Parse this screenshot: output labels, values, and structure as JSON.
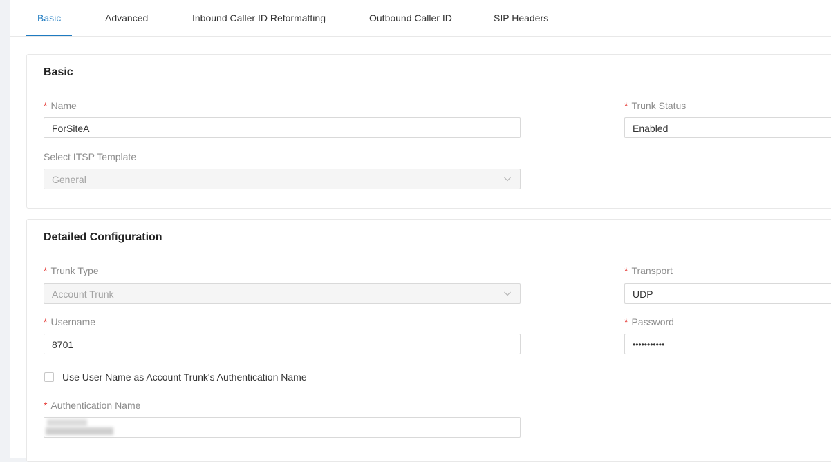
{
  "tabs": [
    {
      "label": "Basic",
      "active": true
    },
    {
      "label": "Advanced"
    },
    {
      "label": "Inbound Caller ID Reformatting"
    },
    {
      "label": "Outbound Caller ID"
    },
    {
      "label": "SIP Headers"
    }
  ],
  "basic": {
    "title": "Basic",
    "name": {
      "label": "Name",
      "value": "ForSiteA"
    },
    "trunk_status": {
      "label": "Trunk Status",
      "value": "Enabled"
    },
    "itsp_template": {
      "label": "Select ITSP Template",
      "value": "General"
    }
  },
  "detailed": {
    "title": "Detailed Configuration",
    "trunk_type": {
      "label": "Trunk Type",
      "value": "Account Trunk"
    },
    "transport": {
      "label": "Transport",
      "value": "UDP"
    },
    "username": {
      "label": "Username",
      "value": "8701"
    },
    "password": {
      "label": "Password",
      "value": "•••••••••••"
    },
    "use_username_checkbox": {
      "label": "Use User Name as Account Trunk's Authentication Name",
      "checked": false
    },
    "auth_name": {
      "label": "Authentication Name",
      "value": ""
    }
  },
  "required_mark": "*",
  "colors": {
    "accent": "#1f7bc1",
    "required": "#e53935"
  }
}
